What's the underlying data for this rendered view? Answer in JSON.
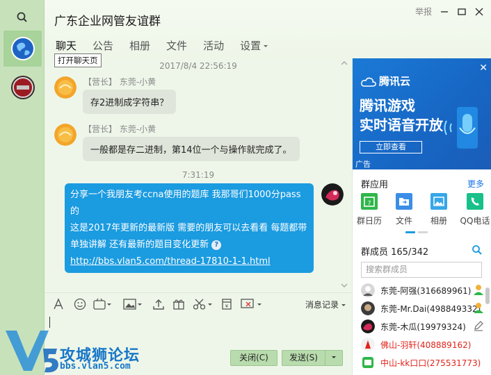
{
  "window": {
    "title": "广东企业网管友谊群",
    "report_label": "举报"
  },
  "tabs": [
    {
      "label": "聊天"
    },
    {
      "label": "公告"
    },
    {
      "label": "相册"
    },
    {
      "label": "文件"
    },
    {
      "label": "活动"
    },
    {
      "label": "设置"
    }
  ],
  "tooltip": "打开聊天页",
  "messages": [
    {
      "time": "2017/8/4 22:56:19",
      "role": "【营长】",
      "sender": "东莞-小黄",
      "text": "存2进制成字符串？"
    },
    {
      "role": "【营长】",
      "sender": "东莞-小黄",
      "text": "一般都是存二进制，第14位一个与操作就完成了。"
    },
    {
      "time": "7:31:19",
      "line1": "分享一个我朋友考ccna使用的题库 我那哥们1000分pass的",
      "line2": "这是2017年更新的最新版 需要的朋友可以去看看 每题都带",
      "line3": "单独讲解 还有最新的题目变化更新",
      "link": "http://bbs.vlan5.com/thread-17810-1-1.html"
    }
  ],
  "toolbar": {
    "message_record": "消息记录"
  },
  "buttons": {
    "close": "关闭(C)",
    "send": "发送(S)"
  },
  "watermark": {
    "title": "攻城狮论坛",
    "url": "bbs.vlan5.com"
  },
  "ad": {
    "brand": "腾讯云",
    "line1": "腾讯游戏",
    "line2": "实时语音开放",
    "cta": "立即查看",
    "tag": "广告"
  },
  "group_apps": {
    "title": "群应用",
    "more": "更多",
    "items": [
      {
        "label": "群日历",
        "icon": "calendar-icon",
        "color": "#2fb64a"
      },
      {
        "label": "文件",
        "icon": "folder-icon",
        "color": "#3a8ee6"
      },
      {
        "label": "相册",
        "icon": "photo-icon",
        "color": "#35a6e8"
      },
      {
        "label": "QQ电话",
        "icon": "phone-icon",
        "color": "#18c08a"
      }
    ]
  },
  "members": {
    "title": "群成员 165/342",
    "search_placeholder": "搜索群成员",
    "list": [
      {
        "name": "东莞-阿强(316689961)",
        "red": false
      },
      {
        "name": "东莞-Mr.Dai(498849332)",
        "red": false
      },
      {
        "name": "东莞-木瓜(19979324)",
        "red": false
      },
      {
        "name": "佛山-羽轩(408889162)",
        "red": true
      },
      {
        "name": "中山-kk口口(275531773)",
        "red": true
      }
    ]
  },
  "colors": {
    "accent": "#1b9be0",
    "sidebar": "#c7e2bb",
    "button": "#b9dcae"
  }
}
